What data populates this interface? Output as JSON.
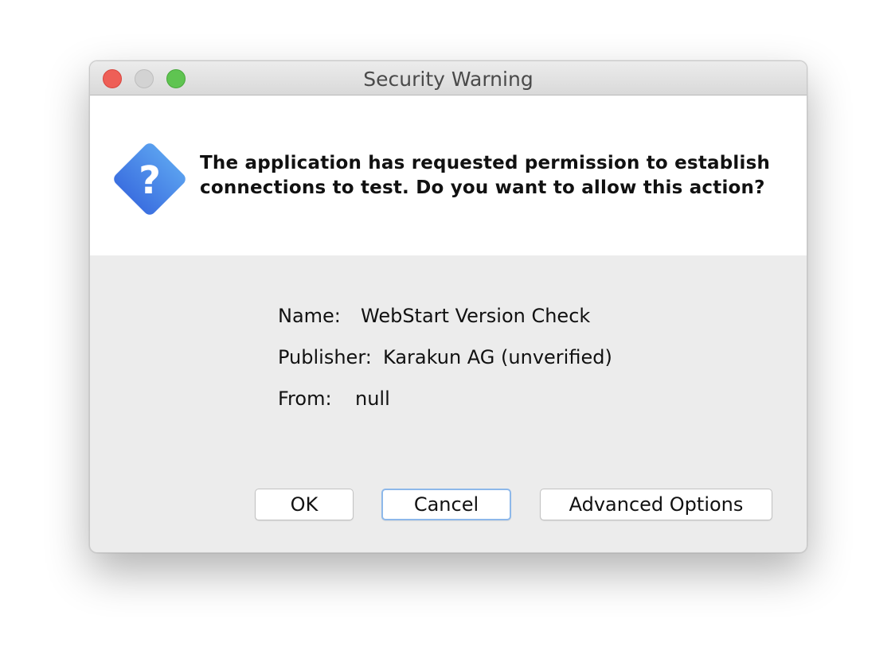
{
  "window": {
    "title": "Security Warning"
  },
  "icon": {
    "name": "question-icon",
    "glyph": "?",
    "color_top": "#5aa0ef",
    "color_bottom": "#3b6fe0"
  },
  "message": {
    "line1": "The application has requested permission to establish",
    "line2": "connections to test. Do you want to allow this action?"
  },
  "details": {
    "name_label": "Name:",
    "name_value": "WebStart Version Check",
    "publisher_label": "Publisher:",
    "publisher_value": "Karakun AG (unverified)",
    "from_label": "From:",
    "from_value": "null"
  },
  "buttons": {
    "ok": "OK",
    "cancel": "Cancel",
    "advanced": "Advanced Options"
  }
}
